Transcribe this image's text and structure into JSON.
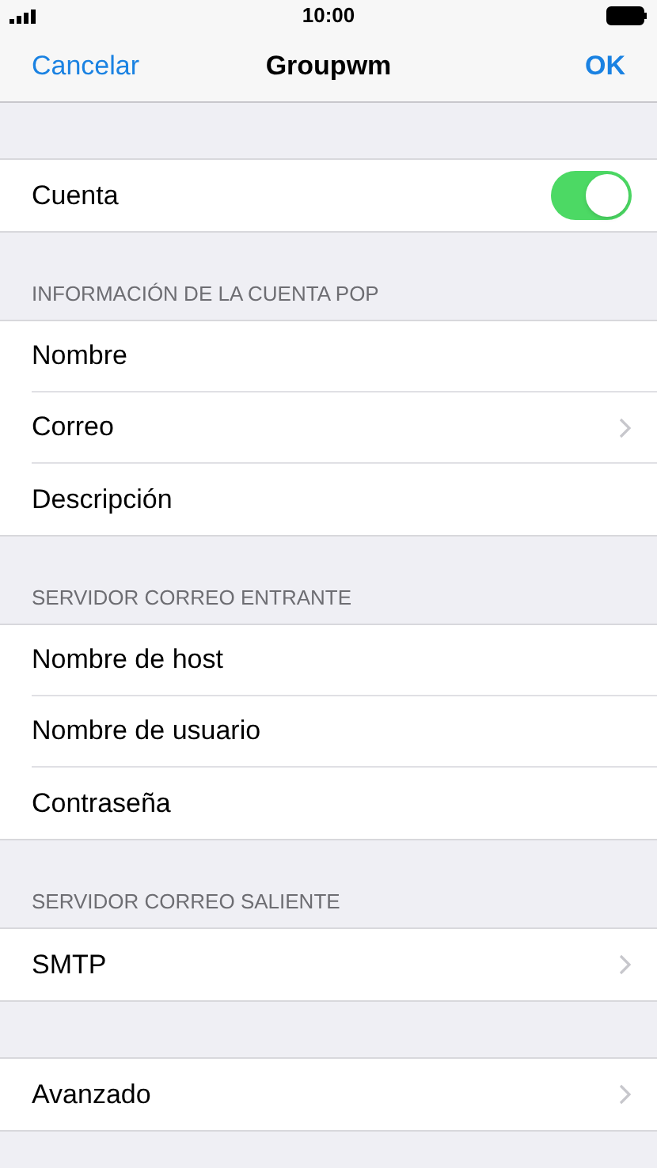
{
  "status_bar": {
    "time": "10:00"
  },
  "nav": {
    "cancel": "Cancelar",
    "title": "Groupwm",
    "done": "OK"
  },
  "sections": [
    {
      "rows": [
        {
          "kind": "toggle",
          "label": "Cuenta",
          "on": true
        }
      ]
    },
    {
      "header": "INFORMACIÓN DE LA CUENTA POP",
      "rows": [
        {
          "kind": "plain",
          "label": "Nombre"
        },
        {
          "kind": "nav",
          "label": "Correo"
        },
        {
          "kind": "plain",
          "label": "Descripción"
        }
      ]
    },
    {
      "header": "SERVIDOR CORREO ENTRANTE",
      "rows": [
        {
          "kind": "plain",
          "label": "Nombre de host"
        },
        {
          "kind": "plain",
          "label": "Nombre de usuario"
        },
        {
          "kind": "plain",
          "label": "Contraseña"
        }
      ]
    },
    {
      "header": "SERVIDOR CORREO SALIENTE",
      "rows": [
        {
          "kind": "nav",
          "label": "SMTP"
        }
      ]
    },
    {
      "rows": [
        {
          "kind": "nav",
          "label": "Avanzado"
        }
      ]
    }
  ]
}
